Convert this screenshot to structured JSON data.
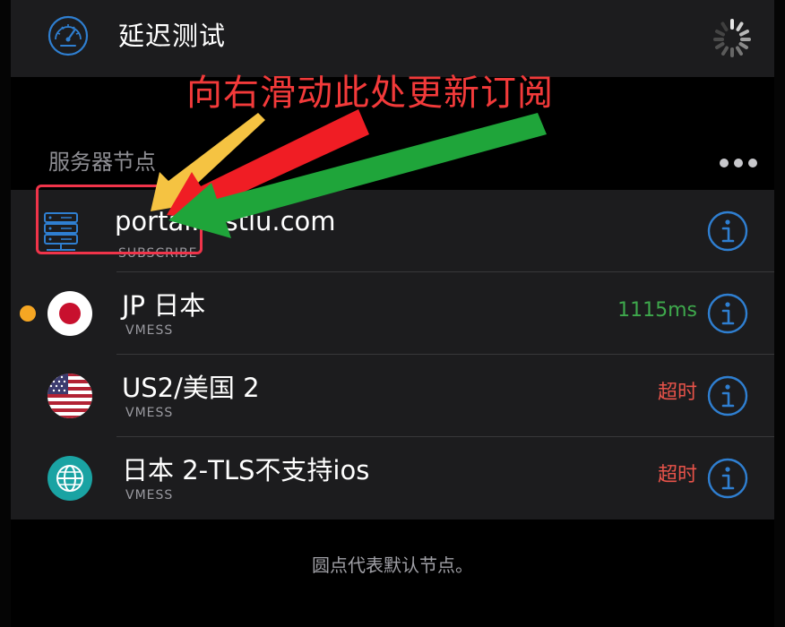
{
  "header": {
    "title": "延迟测试",
    "left_icon": "gauge-icon",
    "right_icon": "spinner-icon"
  },
  "annotation": {
    "text": "向右滑动此处更新订阅",
    "color": "#f23a3a",
    "arrow_colors": [
      "#f5c342",
      "#f01d24",
      "#1fa53a"
    ]
  },
  "section": {
    "title": "服务器节点",
    "more_icon": "more-dots-icon"
  },
  "servers": [
    {
      "name": "portal.fastlu.com",
      "type": "SUBSCRIBE",
      "status": "",
      "icon": "server-icon",
      "is_default": false
    },
    {
      "name": "JP 日本",
      "type": "VMESS",
      "status": "1115ms",
      "status_color": "#3ea84c",
      "icon": "japan-flag-icon",
      "is_default": true
    },
    {
      "name": "US2/美国 2",
      "type": "VMESS",
      "status": "超时",
      "status_color": "#e8534a",
      "icon": "usa-flag-icon",
      "is_default": false
    },
    {
      "name": "日本 2-TLS不支持ios",
      "type": "VMESS",
      "status": "超时",
      "status_color": "#e8534a",
      "icon": "globe-icon",
      "is_default": false
    }
  ],
  "footer": {
    "note": "圆点代表默认节点。"
  },
  "colors": {
    "accent": "#2f7fd1",
    "background": "#000000",
    "card": "#1c1c1e",
    "highlight_box": "#f0344a",
    "default_dot": "#f5a623"
  }
}
